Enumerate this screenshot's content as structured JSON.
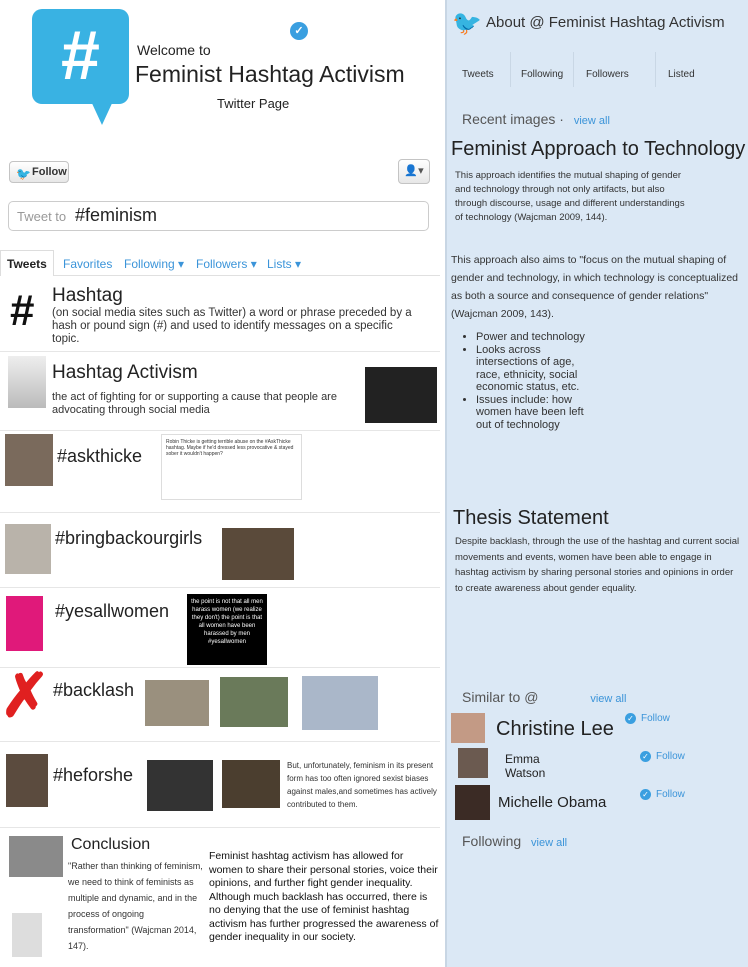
{
  "header": {
    "welcome": "Welcome to",
    "title": "Feminist Hashtag Activism",
    "subtitle": "Twitter Page"
  },
  "actions": {
    "follow_label": "Follow"
  },
  "compose": {
    "placeholder": "Tweet to",
    "value": "#feminism"
  },
  "tabs": [
    "Tweets",
    "Favorites",
    "Following",
    "Followers",
    "Lists"
  ],
  "feed": {
    "hashtag_title": "Hashtag",
    "hashtag_text": "(on social media sites such as Twitter) a word or phrase preceded by a hash or pound sign (#) and used to identify messages on a specific topic.",
    "activism_title": "Hashtag Activism",
    "activism_text": "the act of fighting for or supporting a cause that people are advocating through social media",
    "askthicke": "#askthicke",
    "askthicke_card": "Robin Thicke is getting terrible abuse on the #AskThicke hashtag. Maybe if he'd dressed less provocative & stayed sober it wouldn't happen?",
    "bringbackourgirls": "#bringbackourgirls",
    "yesallwomen": "#yesallwomen",
    "yesallwomen_image": "the point is not that all men harass women (we realize they don't) the point is that all women have been harassed by men #yesallwomen",
    "backlash": "#backlash",
    "heforshe": "#heforshe",
    "heforshe_text": "But, unfortunately, feminism in its present form has too often ignored sexist biases against males,and sometimes has actively contributed to them.",
    "conclusion_title": "Conclusion",
    "conclusion_quote": "\"Rather than thinking of feminism, we need to think of feminists as multiple and dynamic, and in the process of ongoing transformation\" (Wajcman 2014, 147).",
    "conclusion_text": "Feminist hashtag activism has allowed for women to share their personal stories, voice their opinions, and further fight gender inequality. Although much backlash has occurred, there is no denying that the use of feminist hashtag activism has further progressed the awareness of gender inequality in our society."
  },
  "sidebar": {
    "about": "About @  Feminist Hashtag Activism",
    "stats": [
      "Tweets",
      "Following",
      "Followers",
      "Listed"
    ],
    "recent_images": "Recent images",
    "view_all": "view all",
    "approach_title": "Feminist Approach to Technology",
    "approach_p1": "This approach identifies the mutual shaping of gender and technology through not only artifacts, but also through discourse, usage and different understandings of technology (Wajcman 2009, 144).",
    "approach_p2": "This approach also aims to \"focus on the mutual shaping of gender and technology, in which technology is conceptualized as both a source and consequence of gender relations\" (Wajcman 2009, 143).",
    "bullets": [
      "Power and technology",
      "Looks across intersections of age, race, ethnicity, social economic status, etc.",
      "Issues include: how women have been left out of technology"
    ],
    "thesis_title": "Thesis Statement",
    "thesis_text": "Despite backlash, through the use of the hashtag and current social movements and events, women have been able to engage in hashtag activism by sharing personal stories and opinions in order to create awareness about gender equality.",
    "similar": "Similar to @",
    "similar_users": [
      "Christine Lee",
      "Emma Watson",
      "Michelle Obama"
    ],
    "follow": "Follow",
    "following": "Following"
  }
}
